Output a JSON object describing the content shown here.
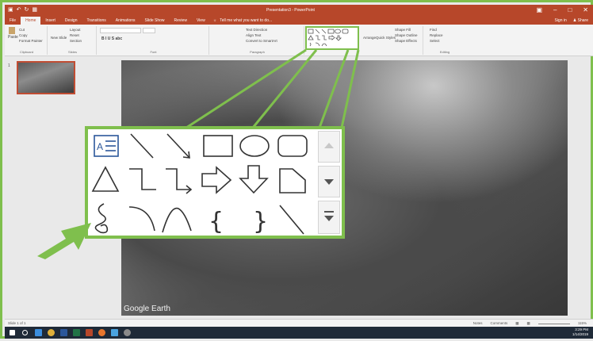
{
  "title_bar": {
    "doc_title": "Presentation3 - PowerPoint",
    "qat_icons": [
      "save-icon",
      "undo-icon",
      "redo-icon",
      "start-from-beginning-icon"
    ]
  },
  "tabs": [
    "File",
    "Home",
    "Insert",
    "Design",
    "Transitions",
    "Animations",
    "Slide Show",
    "Review",
    "View"
  ],
  "active_tab": "Home",
  "tell_me": "Tell me what you want to do...",
  "top_right": {
    "sign_in": "Sign in",
    "share": "Share"
  },
  "ribbon": {
    "clipboard": {
      "paste": "Paste",
      "cut": "Cut",
      "copy": "Copy",
      "format_painter": "Format Painter",
      "label": "Clipboard"
    },
    "slides": {
      "new_slide": "New Slide",
      "layout": "Layout",
      "reset": "Reset",
      "section": "Section",
      "label": "Slides"
    },
    "font": {
      "label": "Font"
    },
    "paragraph": {
      "text_direction": "Text Direction",
      "align_text": "Align Text",
      "convert_smartart": "Convert to SmartArt",
      "label": "Paragraph"
    },
    "drawing": {
      "arrange": "Arrange",
      "quick_styles": "Quick Styles",
      "shape_fill": "Shape Fill",
      "shape_outline": "Shape Outline",
      "shape_effects": "Shape Effects"
    },
    "editing": {
      "find": "Find",
      "replace": "Replace",
      "select": "Select",
      "label": "Editing"
    }
  },
  "slide_thumb": {
    "number": "1"
  },
  "canvas": {
    "watermark": "Google Earth"
  },
  "shapes_gallery": {
    "rows": [
      [
        "text-box-icon",
        "line-icon",
        "arrow-line-icon",
        "rectangle-icon",
        "oval-icon",
        "rounded-rectangle-icon"
      ],
      [
        "triangle-icon",
        "elbow-connector-icon",
        "elbow-arrow-connector-icon",
        "right-arrow-icon",
        "down-arrow-icon",
        "flowchart-icon"
      ],
      [
        "freeform-scribble-icon",
        "arc-icon",
        "curve-icon",
        "left-brace-icon",
        "right-brace-icon",
        "line-icon"
      ]
    ],
    "scroll": [
      "scroll-up-icon",
      "scroll-down-icon",
      "more-icon"
    ]
  },
  "status_bar": {
    "slide_info": "Slide 1 of 1",
    "notes": "Notes",
    "comments": "Comments",
    "zoom": "115%"
  },
  "taskbar": {
    "time": "3:29 PM",
    "date": "1/14/2019"
  },
  "colors": {
    "ppt_red": "#b7472a",
    "highlight_green": "#7fbf4d",
    "taskbar": "#1f2a38"
  }
}
